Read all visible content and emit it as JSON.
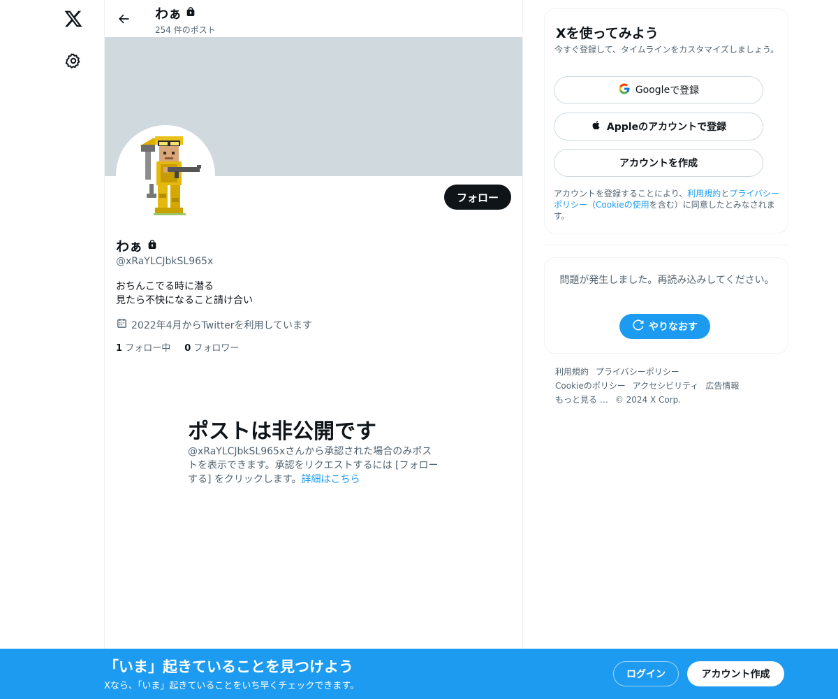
{
  "nav": {
    "logo_icon": "x-logo-icon",
    "settings_icon": "gear-icon"
  },
  "header": {
    "name": "わぁ",
    "post_count": "254 件のポスト",
    "back_icon": "arrow-left-icon",
    "lock_icon": "lock-icon"
  },
  "profile": {
    "name": "わぁ",
    "handle": "@xRaYLCJbkSL965x",
    "bio_line1": "おちんこでる時に潜る",
    "bio_line2": "見たら不快になること請け合い",
    "joined": "2022年4月からTwitterを利用しています",
    "following_count": "1",
    "following_label": "フォロー中",
    "followers_count": "0",
    "followers_label": "フォロワー",
    "follow_button": "フォロー",
    "banner_color": "#cfd9de",
    "avatar_icon": "pixel-character-avatar",
    "calendar_icon": "calendar-icon"
  },
  "private_notice": {
    "title": "ポストは非公開です",
    "desc": "@xRaYLCJbkSL965xさんから承認された場合のみポストを表示できます。承認をリクエストするには [フォローする] をクリックします。",
    "link": "詳細はこちら"
  },
  "signup": {
    "title": "Xを使ってみよう",
    "subtitle": "今すぐ登録して、タイムラインをカスタマイズしましょう。",
    "google_name": "Google",
    "google_suffix": " で登録",
    "apple_btn": "Appleのアカウントで登録",
    "create_btn": "アカウントを作成",
    "terms_pre": "アカウントを登録することにより、",
    "terms_link": "利用規約",
    "terms_and": "と",
    "privacy_link": "プライバシーポリシー",
    "paren_open": "（",
    "cookie_link": "Cookieの使用",
    "terms_post": "を含む）に同意したとみなされます。",
    "google_icon": "google-g-icon",
    "apple_icon": "apple-logo-icon"
  },
  "error": {
    "message": "問題が発生しました。再読み込みしてください。",
    "retry": "やりなおす",
    "retry_icon": "refresh-icon"
  },
  "footer": {
    "terms": "利用規約",
    "privacy": "プライバシーポリシー",
    "cookie": "Cookieのポリシー",
    "accessibility": "アクセシビリティ",
    "ads": "広告情報",
    "more": "もっと見る …",
    "copyright": "© 2024 X Corp."
  },
  "bottom_bar": {
    "title": "「いま」起きていることを見つけよう",
    "subtitle": "Xなら、「いま」起きていることをいち早くチェックできます。",
    "login": "ログイン",
    "create": "アカウント作成"
  },
  "colors": {
    "accent": "#1d9bf0",
    "text": "#0f1419",
    "muted": "#536471",
    "border": "#eff3f4"
  }
}
